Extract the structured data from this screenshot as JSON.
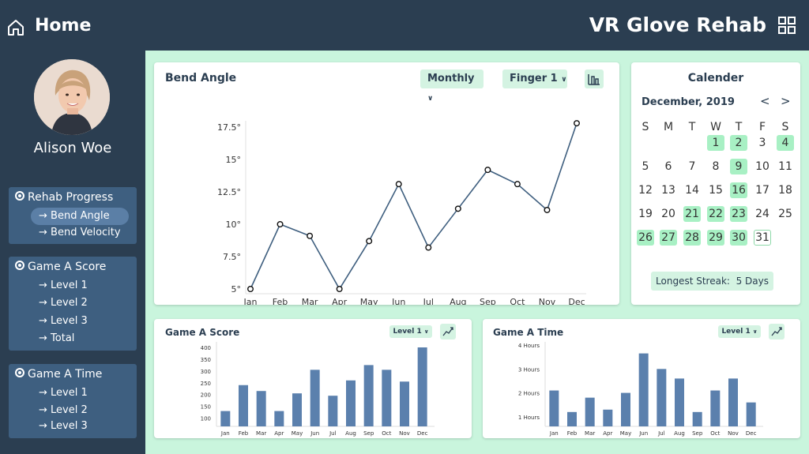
{
  "header": {
    "title": "Home",
    "app_title": "VR Glove Rehab",
    "home_icon": "home-icon",
    "menu_icon": "grid-icon"
  },
  "user": {
    "name": "Alison Woe"
  },
  "nav": {
    "groups": [
      {
        "label": "Rehab Progress",
        "items": [
          "Bend Angle",
          "Bend Velocity"
        ],
        "active": "Bend Angle"
      },
      {
        "label": "Game A Score",
        "items": [
          "Level 1",
          "Level 2",
          "Level 3",
          "Total"
        ]
      },
      {
        "label": "Game A Time",
        "items": [
          "Level 1",
          "Level 2",
          "Level 3"
        ]
      }
    ],
    "arrow": "→"
  },
  "bend": {
    "title": "Bend Angle",
    "period": "Monthly",
    "finger": "Finger 1",
    "chart_data": {
      "type": "line",
      "categories": [
        "Jan",
        "Feb",
        "Mar",
        "Apr",
        "May",
        "Jun",
        "Jul",
        "Aug",
        "Sep",
        "Oct",
        "Nov",
        "Dec"
      ],
      "values": [
        5,
        10,
        9.1,
        5,
        8.7,
        13.1,
        8.2,
        11.2,
        14.2,
        13.1,
        11.1,
        17.8
      ],
      "ylim": [
        5,
        17.5
      ],
      "yticks": [
        "5°",
        "7.5°",
        "10°",
        "12.5°",
        "15°",
        "17.5°"
      ],
      "color": "#3f5f7f"
    }
  },
  "calendar": {
    "title": "Calender",
    "month": "December, 2019",
    "prev": "<",
    "next": ">",
    "weekdays": [
      "S",
      "M",
      "T",
      "W",
      "T",
      "F",
      "S"
    ],
    "start_offset": 3,
    "days": 31,
    "highlighted": [
      1,
      2,
      4,
      9,
      16,
      21,
      22,
      23,
      26,
      27,
      28,
      29,
      30
    ],
    "today": 31,
    "streak_label": "Longest Streak:",
    "streak_value": "5 Days",
    "highlight_color": "#a8f0c4"
  },
  "score": {
    "title": "Game A Score",
    "level": "Level 1",
    "chart_data": {
      "type": "bar",
      "categories": [
        "Jan",
        "Feb",
        "Mar",
        "Apr",
        "May",
        "Jun",
        "Jul",
        "Aug",
        "Sep",
        "Oct",
        "Nov",
        "Dec"
      ],
      "values": [
        130,
        240,
        215,
        130,
        205,
        305,
        195,
        260,
        325,
        305,
        255,
        400
      ],
      "ylim": [
        65,
        410
      ],
      "yticks": [
        "100",
        "150",
        "200",
        "250",
        "300",
        "350",
        "400"
      ],
      "color": "#5b80ad"
    }
  },
  "time": {
    "title": "Game A Time",
    "level": "Level 1",
    "chart_data": {
      "type": "bar",
      "categories": [
        "Jan",
        "Feb",
        "Mar",
        "Apr",
        "May",
        "Jun",
        "Jul",
        "Aug",
        "Sep",
        "Oct",
        "Nov",
        "Dec"
      ],
      "values": [
        2.1,
        1.2,
        1.8,
        1.3,
        2.0,
        3.65,
        3.0,
        2.6,
        1.2,
        2.1,
        2.6,
        1.6
      ],
      "ylim": [
        0.6,
        4.0
      ],
      "yticks": [
        "1 Hours",
        "2 Hours",
        "3 Hours",
        "4 Hours"
      ],
      "color": "#5b80ad"
    }
  }
}
